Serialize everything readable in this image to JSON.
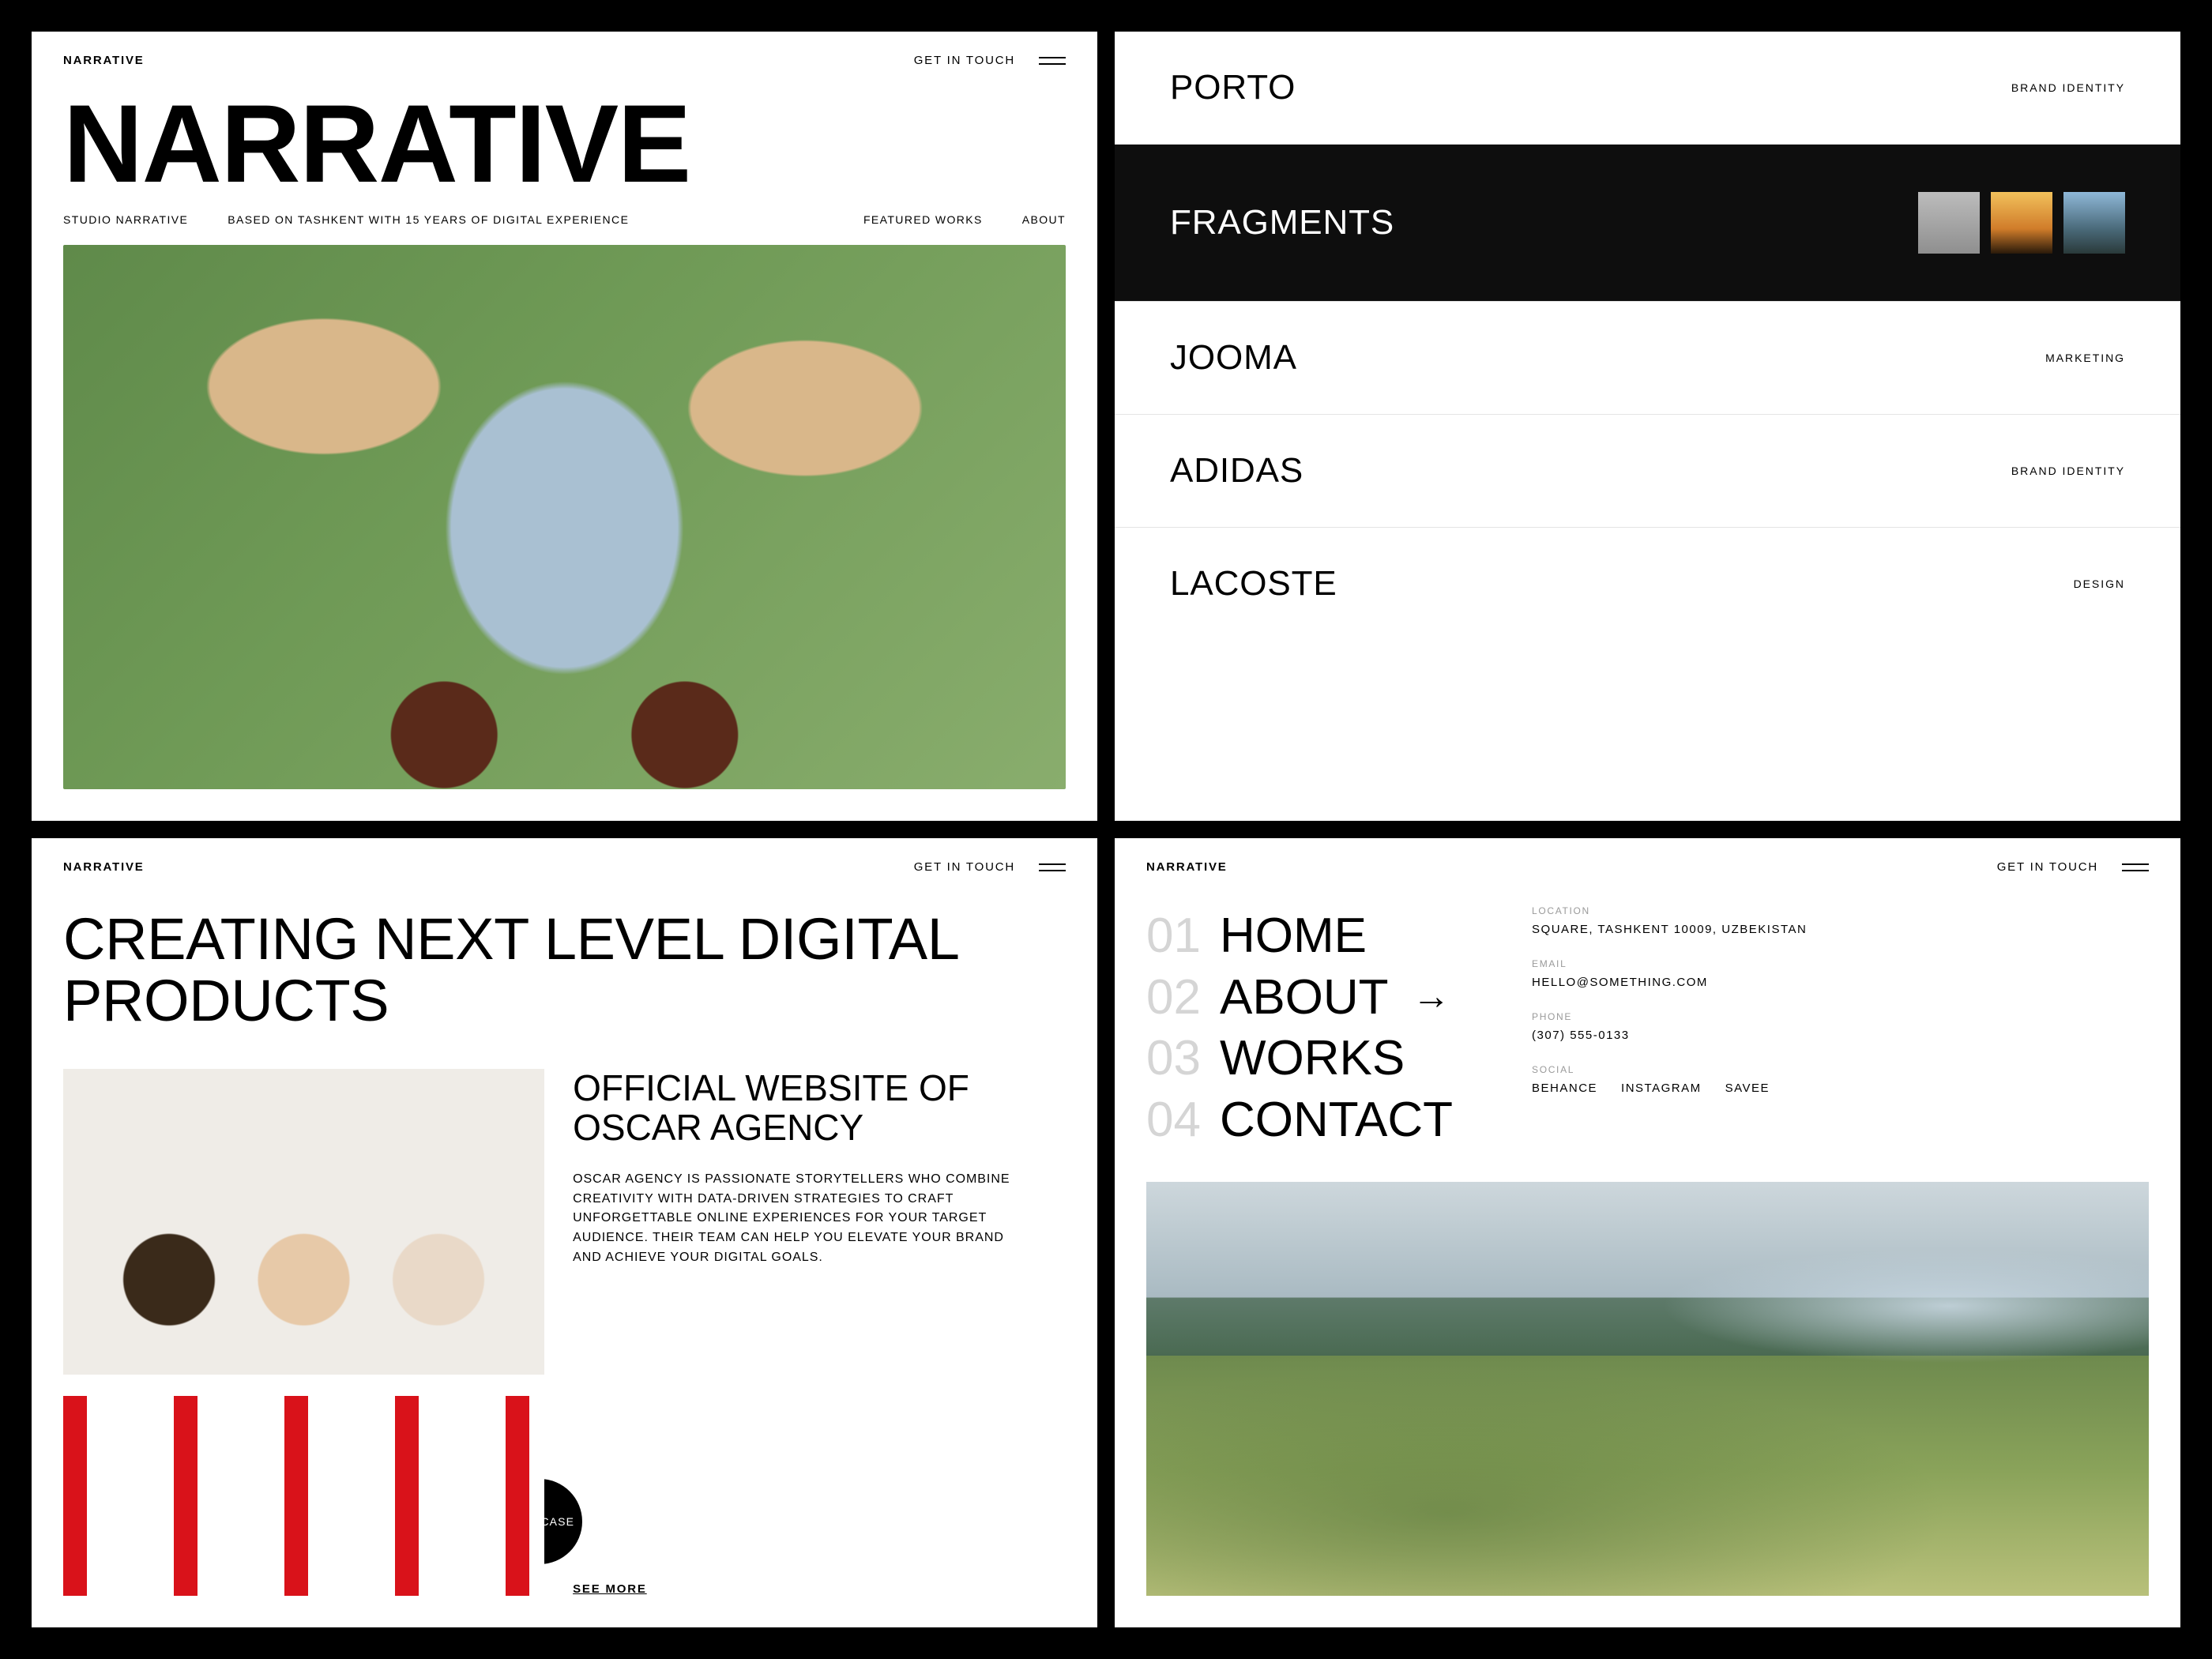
{
  "brand": "NARRATIVE",
  "get_in_touch": "GET IN TOUCH",
  "panel1": {
    "title": "NARRATIVE",
    "studio": "STUDIO NARRATIVE",
    "tagline": "BASED ON TASHKENT WITH 15 YEARS OF DIGITAL EXPERIENCE",
    "nav_featured": "FEATURED WORKS",
    "nav_about": "ABOUT"
  },
  "panel2": {
    "rows": [
      {
        "name": "PORTO",
        "tag": "BRAND IDENTITY",
        "active": false
      },
      {
        "name": "FRAGMENTS",
        "tag": "",
        "active": true
      },
      {
        "name": "JOOMA",
        "tag": "MARKETING",
        "active": false
      },
      {
        "name": "ADIDAS",
        "tag": "BRAND IDENTITY",
        "active": false
      },
      {
        "name": "LACOSTE",
        "tag": "DESIGN",
        "active": false
      }
    ]
  },
  "panel3": {
    "headline": "CREATING NEXT LEVEL DIGITAL PRODUCTS",
    "case_title": "OFFICIAL WEBSITE OF OSCAR AGENCY",
    "case_body": "OSCAR AGENCY IS PASSIONATE STORYTELLERS WHO COMBINE CREATIVITY WITH DATA-DRIVEN STRATEGIES TO CRAFT UNFORGETTABLE ONLINE EXPERIENCES FOR YOUR TARGET AUDIENCE.  THEIR TEAM CAN HELP YOU ELEVATE YOUR BRAND AND ACHIEVE YOUR DIGITAL GOALS.",
    "view_case": "VIEW CASE",
    "see_more": "SEE MORE"
  },
  "panel4": {
    "menu": [
      {
        "num": "01",
        "label": "HOME",
        "active": false
      },
      {
        "num": "02",
        "label": "ABOUT",
        "active": true
      },
      {
        "num": "03",
        "label": "WORKS",
        "active": false
      },
      {
        "num": "04",
        "label": "CONTACT",
        "active": false
      }
    ],
    "location_lbl": "LOCATION",
    "location": "SQUARE, TASHKENT 10009, UZBEKISTAN",
    "email_lbl": "EMAIL",
    "email": "HELLO@SOMETHING.COM",
    "phone_lbl": "PHONE",
    "phone": "(307) 555-0133",
    "social_lbl": "SOCIAL",
    "socials": [
      "BEHANCE",
      "INSTAGRAM",
      "SAVEE"
    ]
  }
}
